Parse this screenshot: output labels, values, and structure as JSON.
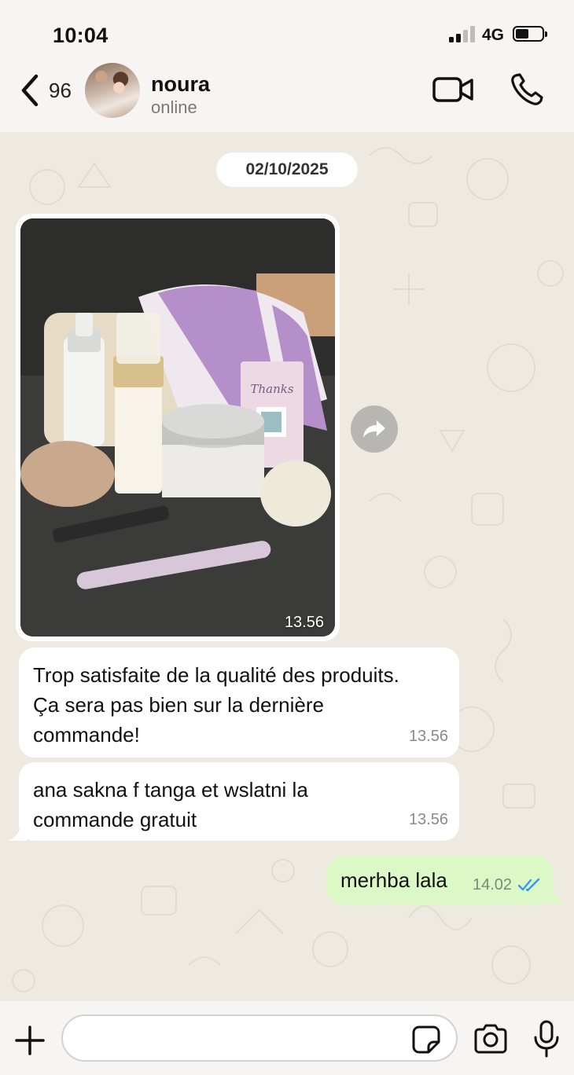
{
  "status_bar": {
    "time": "10:04",
    "network": "4G",
    "signal_bars": 2,
    "battery_level": 0.45
  },
  "header": {
    "back_count": "96",
    "contact_name": "noura",
    "contact_status": "online",
    "icons": {
      "back": "chevron-left-icon",
      "video": "video-camera-icon",
      "call": "phone-icon"
    }
  },
  "chat": {
    "date_chip": "02/10/2025",
    "image_message": {
      "time": "13.56",
      "photo_text": "Thanks"
    },
    "incoming": [
      {
        "lines": [
          "Trop satisfaite de la qualité des produits.",
          "Ça sera pas bien sur la dernière",
          "commande!"
        ],
        "time": "13.56"
      },
      {
        "lines": [
          "ana sakna f tanga et wslatni la",
          "commande  gratuit"
        ],
        "time": "13.56"
      }
    ],
    "outgoing": [
      {
        "text": "merhba lala",
        "time": "14.02",
        "status": "read"
      }
    ]
  },
  "composer": {
    "placeholder": "",
    "icons": {
      "attach": "plus-icon",
      "sticker": "sticker-icon",
      "camera": "camera-icon",
      "mic": "microphone-icon"
    }
  },
  "colors": {
    "outgoing_bubble": "#dcf8c6",
    "read_ticks": "#3497f9",
    "background": "#efeae1"
  }
}
